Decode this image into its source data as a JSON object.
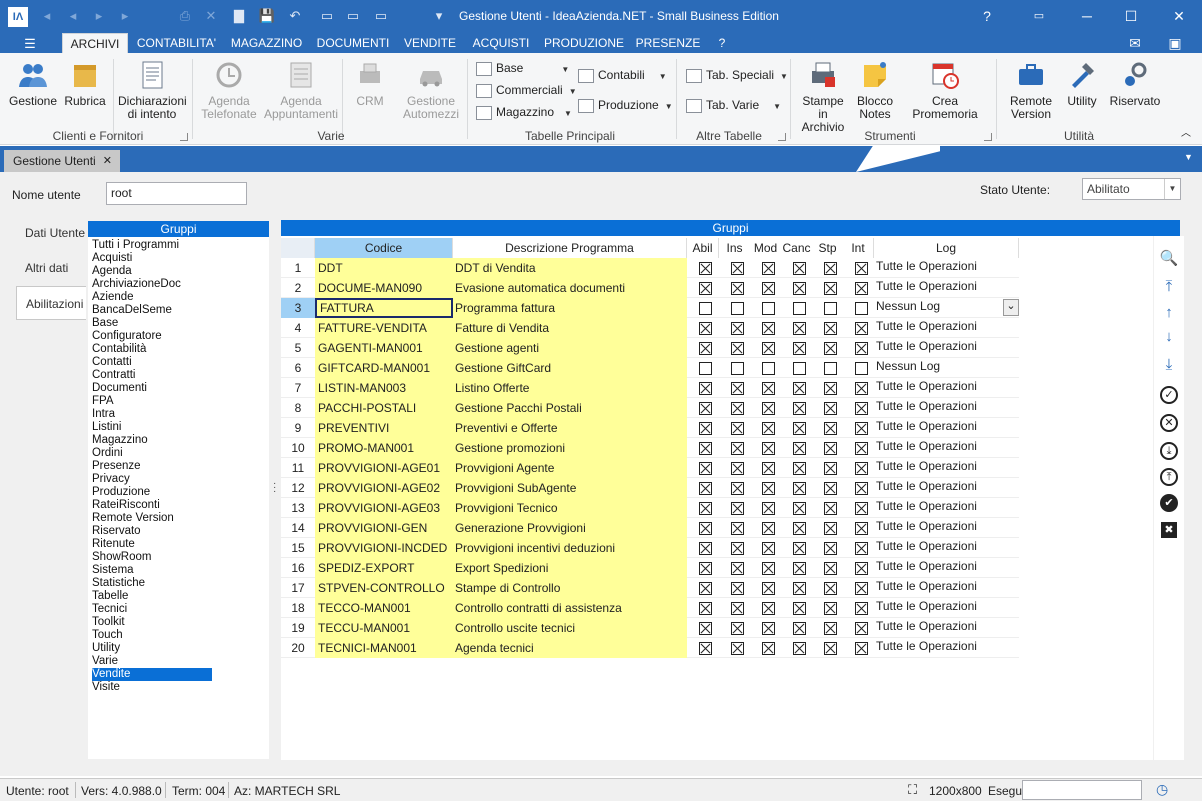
{
  "window": {
    "title": "Gestione Utenti - IdeaAzienda.NET - Small Business Edition",
    "help": "?",
    "minimize": "─",
    "maximize": "☐",
    "close": "✕"
  },
  "quickaccess": [
    "◂",
    "◂",
    "▸",
    "▸",
    "⎙",
    "✕",
    "▇",
    "💾",
    "↶",
    "▭",
    "▭",
    "▭",
    "▾"
  ],
  "menu": {
    "file_glyph": "☰",
    "tabs": [
      "ARCHIVI",
      "CONTABILITA'",
      "MAGAZZINO",
      "DOCUMENTI",
      "VENDITE",
      "ACQUISTI",
      "PRODUZIONE",
      "PRESENZE",
      "?"
    ],
    "mail_glyph": "✉"
  },
  "ribbon": {
    "gestione": "Gestione",
    "rubrica": "Rubrica",
    "dichiarazioni": "Dichiarazioni di intento",
    "group_clienti": "Clienti e Fornitori",
    "agenda_tel": "Agenda Telefonate",
    "agenda_app": "Agenda Appuntamenti",
    "crm": "CRM",
    "gest_autom": "Gestione Automezzi",
    "group_varie": "Varie",
    "base": "Base",
    "commerciali": "Commerciali",
    "magazzino": "Magazzino",
    "contabili": "Contabili",
    "produzione": "Produzione",
    "group_tabelle": "Tabelle Principali",
    "tab_speciali": "Tab. Speciali",
    "tab_varie": "Tab. Varie",
    "group_altre": "Altre Tabelle",
    "stampe_archivio": "Stampe in Archivio",
    "blocco_notes": "Blocco Notes",
    "crea_promemoria": "Crea Promemoria",
    "group_strumenti": "Strumenti",
    "remote_version": "Remote Version",
    "utility": "Utility",
    "riservato": "Riservato",
    "group_utilita": "Utilità"
  },
  "doc_tab": {
    "label": "Gestione Utenti",
    "close": "✕"
  },
  "form": {
    "nome_label": "Nome utente",
    "nome_value": "root",
    "stato_label": "Stato Utente:",
    "stato_value": "Abilitato"
  },
  "side_tabs": [
    "Dati Utente",
    "Altri dati",
    "Abilitazioni"
  ],
  "groups_header": "Gruppi",
  "groups": [
    "Tutti i Programmi",
    "Acquisti",
    "Agenda",
    "ArchiviazioneDoc",
    "Aziende",
    "BancaDelSeme",
    "Base",
    "Configuratore",
    "Contabilità",
    "Contatti",
    "Contratti",
    "Documenti",
    "FPA",
    "Intra",
    "Listini",
    "Magazzino",
    "Ordini",
    "Presenze",
    "Privacy",
    "Produzione",
    "RateiRisconti",
    "Remote Version",
    "Riservato",
    "Ritenute",
    "ShowRoom",
    "Sistema",
    "Statistiche",
    "Tabelle",
    "Tecnici",
    "Toolkit",
    "Touch",
    "Utility",
    "Varie",
    "Vendite",
    "Visite"
  ],
  "selected_group": "Vendite",
  "grid": {
    "header": "Gruppi",
    "columns": [
      "Codice",
      "Descrizione Programma",
      "Abil",
      "Ins",
      "Mod",
      "Canc",
      "Stp",
      "Int",
      "Log"
    ],
    "rows": [
      {
        "n": "1",
        "codice": "DDT",
        "descr": "DDT di Vendita",
        "checks": [
          1,
          1,
          1,
          1,
          1,
          1
        ],
        "log": "Tutte le Operazioni"
      },
      {
        "n": "2",
        "codice": "DOCUME-MAN090",
        "descr": "Evasione automatica documenti",
        "checks": [
          1,
          1,
          1,
          1,
          1,
          1
        ],
        "log": "Tutte le Operazioni"
      },
      {
        "n": "3",
        "codice": "FATTURA",
        "descr": "Programma fattura",
        "checks": [
          0,
          0,
          0,
          0,
          0,
          0
        ],
        "log": "Nessun Log"
      },
      {
        "n": "4",
        "codice": "FATTURE-VENDITA",
        "descr": "Fatture di Vendita",
        "checks": [
          1,
          1,
          1,
          1,
          1,
          1
        ],
        "log": "Tutte le Operazioni"
      },
      {
        "n": "5",
        "codice": "GAGENTI-MAN001",
        "descr": "Gestione agenti",
        "checks": [
          1,
          1,
          1,
          1,
          1,
          1
        ],
        "log": "Tutte le Operazioni"
      },
      {
        "n": "6",
        "codice": "GIFTCARD-MAN001",
        "descr": "Gestione GiftCard",
        "checks": [
          0,
          0,
          0,
          0,
          0,
          0
        ],
        "log": "Nessun Log"
      },
      {
        "n": "7",
        "codice": "LISTIN-MAN003",
        "descr": "Listino Offerte",
        "checks": [
          1,
          1,
          1,
          1,
          1,
          1
        ],
        "log": "Tutte le Operazioni"
      },
      {
        "n": "8",
        "codice": "PACCHI-POSTALI",
        "descr": "Gestione Pacchi Postali",
        "checks": [
          1,
          1,
          1,
          1,
          1,
          1
        ],
        "log": "Tutte le Operazioni"
      },
      {
        "n": "9",
        "codice": "PREVENTIVI",
        "descr": "Preventivi e Offerte",
        "checks": [
          1,
          1,
          1,
          1,
          1,
          1
        ],
        "log": "Tutte le Operazioni"
      },
      {
        "n": "10",
        "codice": "PROMO-MAN001",
        "descr": "Gestione promozioni",
        "checks": [
          1,
          1,
          1,
          1,
          1,
          1
        ],
        "log": "Tutte le Operazioni"
      },
      {
        "n": "11",
        "codice": "PROVVIGIONI-AGE01",
        "descr": "Provvigioni Agente",
        "checks": [
          1,
          1,
          1,
          1,
          1,
          1
        ],
        "log": "Tutte le Operazioni"
      },
      {
        "n": "12",
        "codice": "PROVVIGIONI-AGE02",
        "descr": "Provvigioni SubAgente",
        "checks": [
          1,
          1,
          1,
          1,
          1,
          1
        ],
        "log": "Tutte le Operazioni"
      },
      {
        "n": "13",
        "codice": "PROVVIGIONI-AGE03",
        "descr": "Provvigioni Tecnico",
        "checks": [
          1,
          1,
          1,
          1,
          1,
          1
        ],
        "log": "Tutte le Operazioni"
      },
      {
        "n": "14",
        "codice": "PROVVIGIONI-GEN",
        "descr": "Generazione Provvigioni",
        "checks": [
          1,
          1,
          1,
          1,
          1,
          1
        ],
        "log": "Tutte le Operazioni"
      },
      {
        "n": "15",
        "codice": "PROVVIGIONI-INCDED",
        "descr": "Provvigioni incentivi deduzioni",
        "checks": [
          1,
          1,
          1,
          1,
          1,
          1
        ],
        "log": "Tutte le Operazioni"
      },
      {
        "n": "16",
        "codice": "SPEDIZ-EXPORT",
        "descr": "Export Spedizioni",
        "checks": [
          1,
          1,
          1,
          1,
          1,
          1
        ],
        "log": "Tutte le Operazioni"
      },
      {
        "n": "17",
        "codice": "STPVEN-CONTROLLO",
        "descr": "Stampe di Controllo",
        "checks": [
          1,
          1,
          1,
          1,
          1,
          1
        ],
        "log": "Tutte le Operazioni"
      },
      {
        "n": "18",
        "codice": "TECCO-MAN001",
        "descr": "Controllo contratti di assistenza",
        "checks": [
          1,
          1,
          1,
          1,
          1,
          1
        ],
        "log": "Tutte le Operazioni"
      },
      {
        "n": "19",
        "codice": "TECCU-MAN001",
        "descr": "Controllo uscite tecnici",
        "checks": [
          1,
          1,
          1,
          1,
          1,
          1
        ],
        "log": "Tutte le Operazioni"
      },
      {
        "n": "20",
        "codice": "TECNICI-MAN001",
        "descr": "Agenda tecnici",
        "checks": [
          1,
          1,
          1,
          1,
          1,
          1
        ],
        "log": "Tutte le Operazioni"
      }
    ],
    "selected_row": "3"
  },
  "tools": [
    {
      "name": "search-icon",
      "glyph": "🔍"
    },
    {
      "name": "move-first-icon",
      "glyph": "⤒"
    },
    {
      "name": "move-up-icon",
      "glyph": "↑"
    },
    {
      "name": "move-down-icon",
      "glyph": "↓"
    },
    {
      "name": "move-last-icon",
      "glyph": "⤓"
    },
    {
      "name": "check-circle-icon",
      "glyph": "✓"
    },
    {
      "name": "cancel-circle-icon",
      "glyph": "✕"
    },
    {
      "name": "download-circle-icon",
      "glyph": "⤓"
    },
    {
      "name": "upload-circle-icon",
      "glyph": "⤒"
    },
    {
      "name": "confirm-filled-icon",
      "glyph": "✔"
    },
    {
      "name": "close-box-icon",
      "glyph": "✖"
    }
  ],
  "status": {
    "utente": "Utente: root",
    "vers": "Vers: 4.0.988.0",
    "term": "Term: 004",
    "az": "Az: MARTECH SRL",
    "res": "1200x800",
    "esegui": "Esegui"
  },
  "colors": {
    "accent": "#2b6bb8",
    "header_blue": "#0a6fd6",
    "row_yellow": "#ffff99"
  }
}
